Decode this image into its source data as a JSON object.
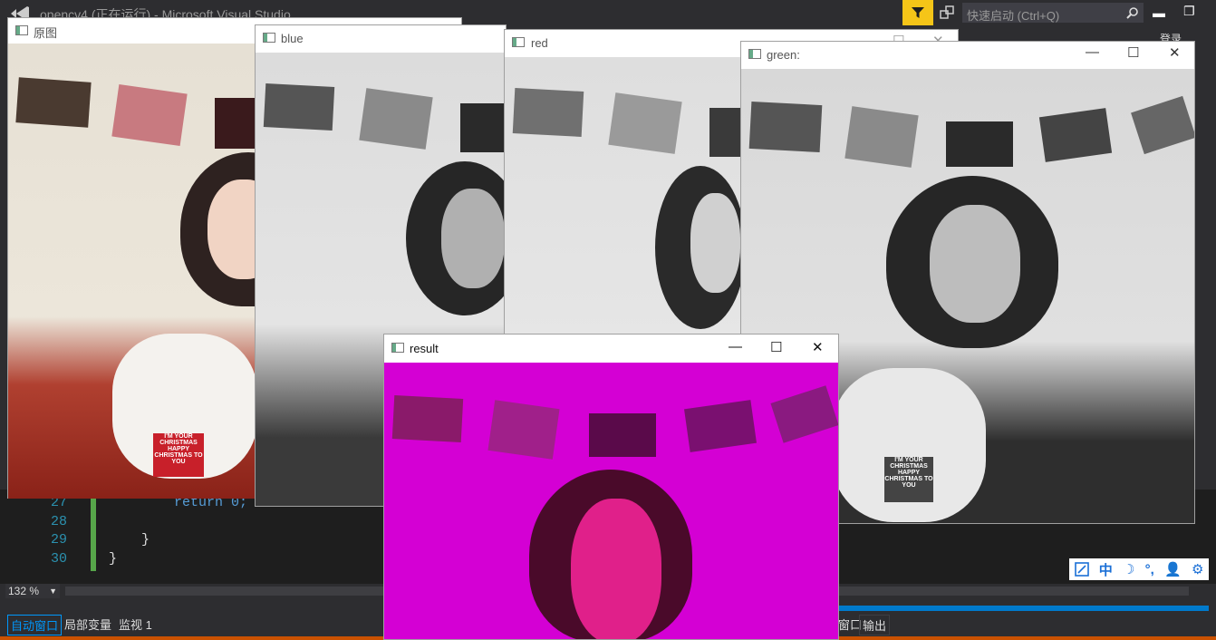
{
  "vs": {
    "title": "opencv4 (正在运行) - Microsoft Visual Studio",
    "quicklaunch_placeholder": "快速启动 (Ctrl+Q)",
    "login": "登录",
    "zoom": "132 %",
    "lines": [
      "27",
      "28",
      "29",
      "30"
    ],
    "code_return": "return 0;",
    "code_brace1": "}",
    "code_brace2": "}",
    "bottom_tabs": [
      "自动窗口",
      "局部变量",
      "监视 1"
    ],
    "output_tabs": [
      "窗口",
      "输出"
    ]
  },
  "windows": {
    "original": "原图",
    "blue": "blue",
    "red": "red",
    "green": "green:",
    "result": "result"
  },
  "photo_text": "I'M YOUR CHRISTMAS HAPPY CHRISTMAS TO YOU",
  "ime": [
    "中",
    "☽",
    "°,",
    "👤",
    "⚙"
  ],
  "icons": [
    "filter-icon",
    "connect-icon",
    "search-icon",
    "minimize-icon",
    "maximize-icon",
    "close-icon",
    "vs-logo-icon"
  ]
}
